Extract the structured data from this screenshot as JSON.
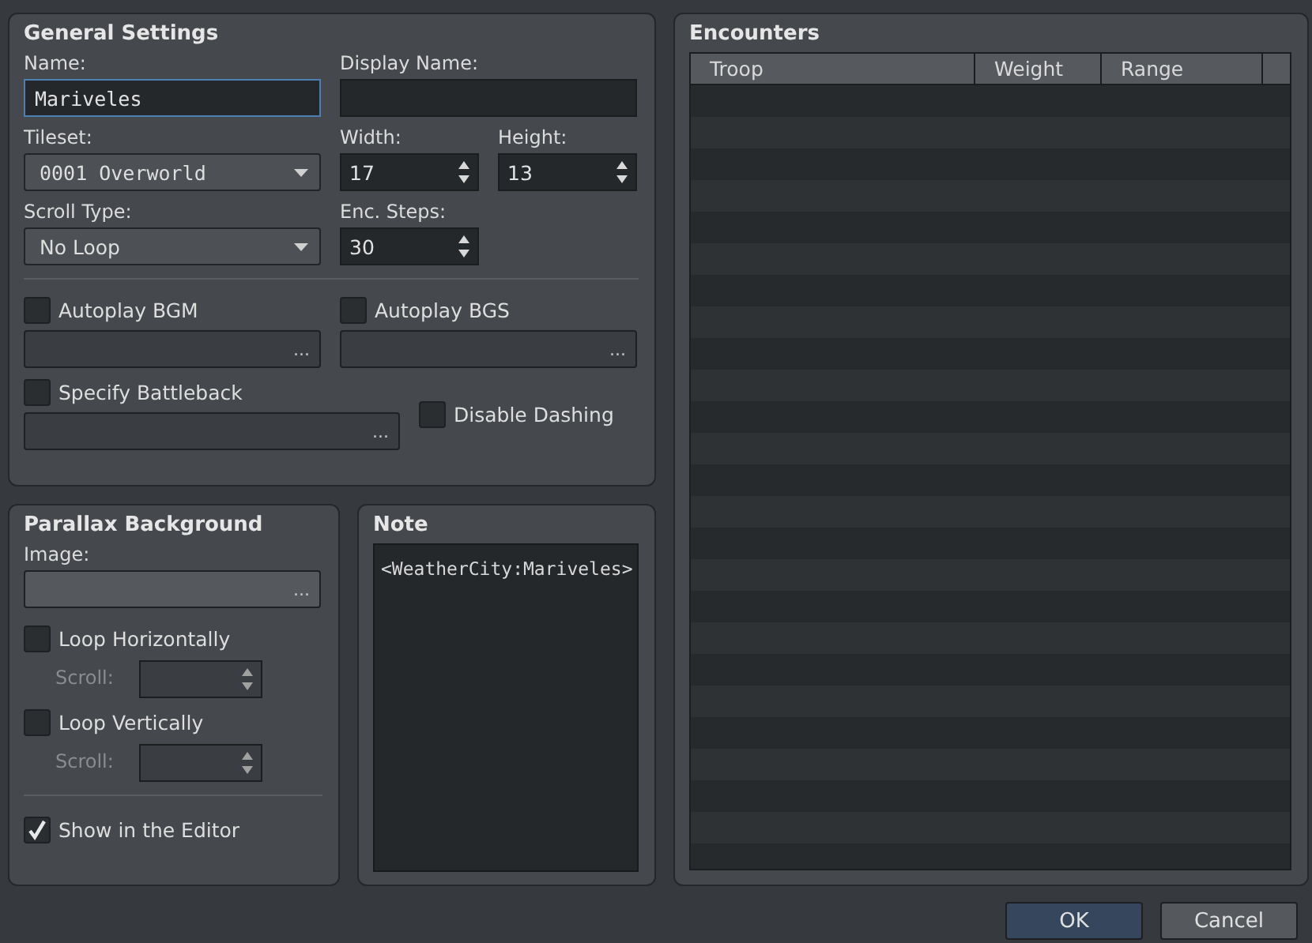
{
  "general_settings": {
    "title": "General Settings",
    "name": {
      "label": "Name:",
      "value": "Mariveles",
      "focused": true
    },
    "display_name": {
      "label": "Display Name:"
    },
    "tileset": {
      "label": "Tileset:",
      "value": "0001 Overworld"
    },
    "width": {
      "label": "Width:",
      "value": "17"
    },
    "height": {
      "label": "Height:",
      "value": "13"
    },
    "scroll_type": {
      "label": "Scroll Type:",
      "value": "No Loop"
    },
    "enc_steps": {
      "label": "Enc. Steps:",
      "value": "30"
    },
    "autoplay_bgm": {
      "label": "Autoplay BGM",
      "checked": false,
      "browse": "..."
    },
    "autoplay_bgs": {
      "label": "Autoplay BGS",
      "checked": false,
      "browse": "..."
    },
    "specify_battleback": {
      "label": "Specify Battleback",
      "checked": false,
      "browse": "..."
    },
    "disable_dashing": {
      "label": "Disable Dashing",
      "checked": false
    }
  },
  "parallax_background": {
    "title": "Parallax Background",
    "image": {
      "label": "Image:",
      "browse": "..."
    },
    "loop_horizontally": {
      "label": "Loop Horizontally",
      "checked": false,
      "scroll_label": "Scroll:",
      "scroll_disabled": true
    },
    "loop_vertically": {
      "label": "Loop Vertically",
      "checked": false,
      "scroll_label": "Scroll:",
      "scroll_disabled": true
    },
    "show_in_editor": {
      "label": "Show in the Editor",
      "checked": true
    }
  },
  "note": {
    "title": "Note",
    "text": "<WeatherCity:Mariveles>"
  },
  "encounters": {
    "title": "Encounters",
    "columns": [
      "Troop",
      "Weight",
      "Range"
    ]
  },
  "buttons": [
    {
      "label": "OK",
      "kind": "primary"
    },
    {
      "label": "Cancel",
      "kind": "secondary"
    }
  ]
}
